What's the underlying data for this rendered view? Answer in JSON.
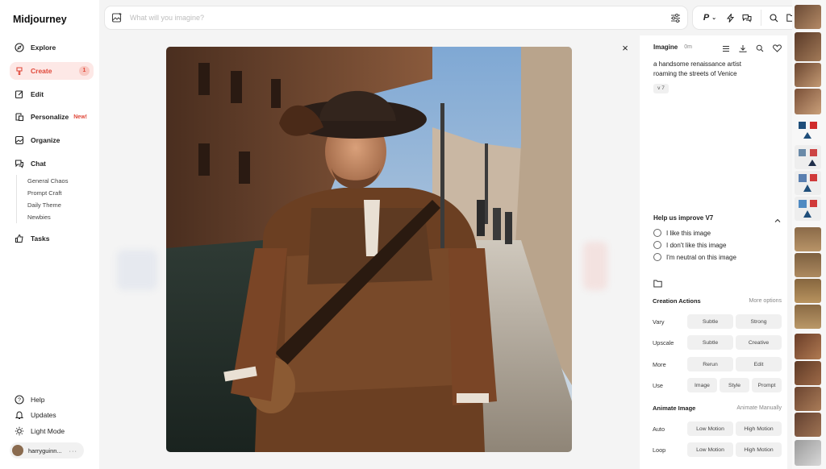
{
  "app": {
    "name": "Midjourney"
  },
  "sidebar": {
    "items": [
      {
        "label": "Explore",
        "icon": "compass-icon"
      },
      {
        "label": "Create",
        "icon": "brush-icon",
        "badge": "1"
      },
      {
        "label": "Edit",
        "icon": "edit-icon"
      },
      {
        "label": "Personalize",
        "icon": "personalize-icon",
        "tag": "New!"
      },
      {
        "label": "Organize",
        "icon": "image-grid-icon"
      },
      {
        "label": "Chat",
        "icon": "chat-icon"
      },
      {
        "label": "Tasks",
        "icon": "thumbs-up-icon"
      }
    ],
    "chat_rooms": [
      "General Chaos",
      "Prompt Craft",
      "Daily Theme",
      "Newbies"
    ],
    "bottom": [
      {
        "label": "Help",
        "icon": "help-icon"
      },
      {
        "label": "Updates",
        "icon": "bell-icon"
      },
      {
        "label": "Light Mode",
        "icon": "sun-icon"
      }
    ],
    "user": {
      "name": "harryguinn...",
      "more": "···"
    }
  },
  "search": {
    "placeholder": "What will you imagine?",
    "value": ""
  },
  "toolbar": {
    "personalize_label": "P",
    "icons": [
      "settings-sliders-icon",
      "lightning-icon",
      "chat-bubbles-icon",
      "search-icon",
      "folder-icon"
    ]
  },
  "close_label": "×",
  "panel": {
    "title": "Imagine",
    "time": "0m",
    "prompt": "a handsome renaissance artist roaming the streets of Venice",
    "version": "v 7",
    "help_title": "Help us improve V7",
    "feedback_options": [
      "I like this image",
      "I don't like this image",
      "I'm neutral on this image"
    ],
    "creation_title": "Creation Actions",
    "more_options": "More options",
    "rows": [
      {
        "label": "Vary",
        "buttons": [
          "Subtle",
          "Strong"
        ]
      },
      {
        "label": "Upscale",
        "buttons": [
          "Subtle",
          "Creative"
        ]
      },
      {
        "label": "More",
        "buttons": [
          "Rerun",
          "Edit"
        ]
      },
      {
        "label": "Use",
        "buttons": [
          "Image",
          "Style",
          "Prompt"
        ]
      }
    ],
    "animate_title": "Animate Image",
    "animate_manually": "Animate Manually",
    "animate_rows": [
      {
        "label": "Auto",
        "buttons": [
          "Low Motion",
          "High Motion"
        ]
      },
      {
        "label": "Loop",
        "buttons": [
          "Low Motion",
          "High Motion"
        ]
      }
    ]
  },
  "colors": {
    "accent": "#e0483a",
    "accent_bg": "#fde8e6"
  }
}
